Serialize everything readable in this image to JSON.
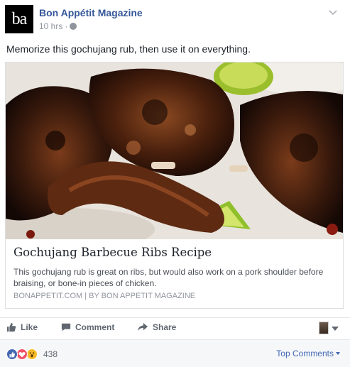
{
  "post": {
    "avatar_text": "ba",
    "page_name": "Bon Appétit Magazine",
    "time": "10 hrs",
    "separator": "·",
    "message": "Memorize this gochujang rub, then use it on everything."
  },
  "card": {
    "image_icon": "grilled-ribs-photo",
    "title": "Gochujang Barbecue Ribs Recipe",
    "description": "This gochujang rub is great on ribs, but would also work on a pork shoulder before braising, or bone-in pieces of chicken.",
    "source": "BONAPPETIT.COM  |  BY BON APPETIT MAGAZINE"
  },
  "actions": {
    "like": "Like",
    "comment": "Comment",
    "share": "Share"
  },
  "reactions": {
    "count": "438",
    "top_comments": "Top Comments",
    "colors": {
      "like": "#4267b2",
      "love": "#f25268",
      "wow": "#f7b928"
    }
  },
  "colors": {
    "link": "#365899",
    "accent": "#4267b2",
    "muted": "#90949c"
  }
}
